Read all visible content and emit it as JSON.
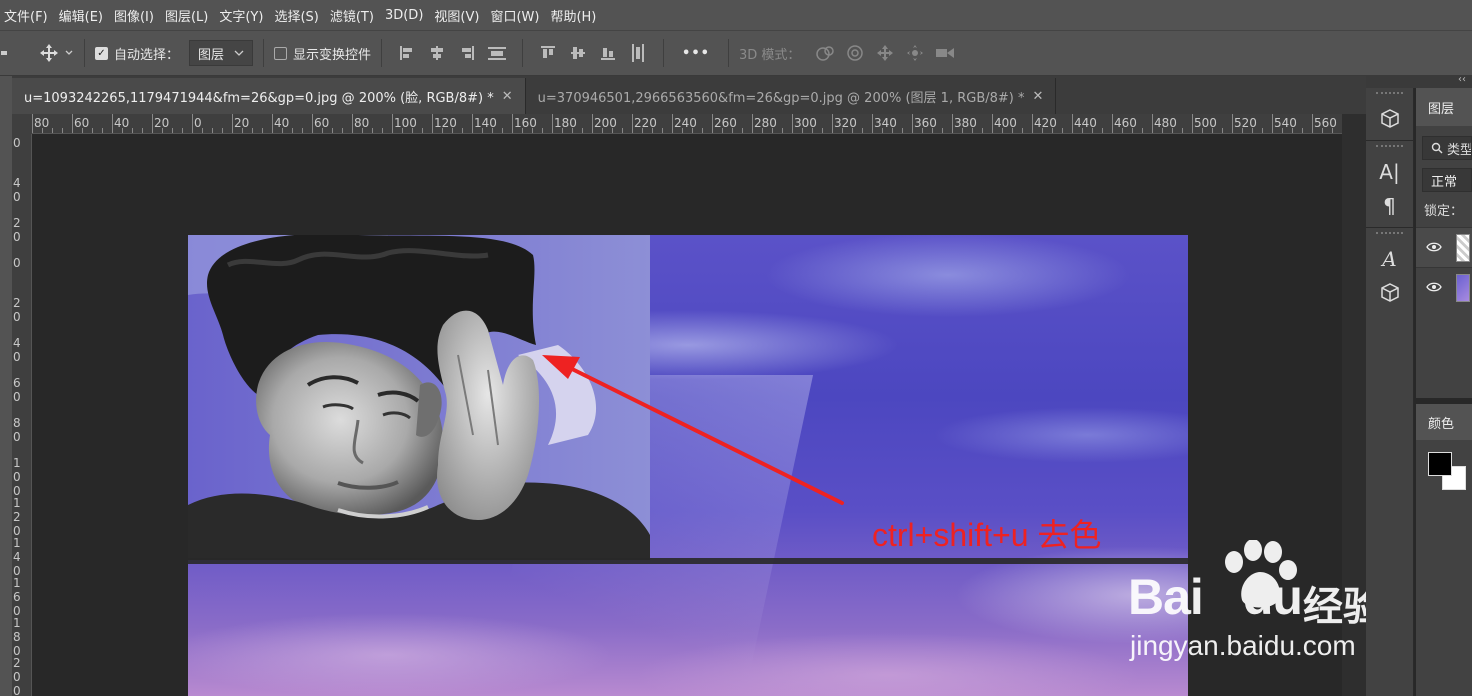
{
  "menu": [
    "文件(F)",
    "编辑(E)",
    "图像(I)",
    "图层(L)",
    "文字(Y)",
    "选择(S)",
    "滤镜(T)",
    "3D(D)",
    "视图(V)",
    "窗口(W)",
    "帮助(H)"
  ],
  "options": {
    "auto_select_label": "自动选择：",
    "auto_select_checked": true,
    "auto_select_target": "图层",
    "show_transform_label": "显示变换控件",
    "show_transform_checked": false,
    "more_label": "•••",
    "mode_3d_label": "3D 模式："
  },
  "tabs": [
    {
      "title": "u=1093242265,1179471944&fm=26&gp=0.jpg @ 200% (脸, RGB/8#) *",
      "active": true
    },
    {
      "title": "u=370946501,2966563560&fm=26&gp=0.jpg @ 200% (图层 1, RGB/8#) *",
      "active": false
    }
  ],
  "ruler": {
    "h_labels": [
      "80",
      "60",
      "40",
      "20",
      "0",
      "20",
      "40",
      "60",
      "80",
      "100",
      "120",
      "140",
      "160",
      "180",
      "200",
      "220",
      "240",
      "260",
      "280",
      "300",
      "320",
      "340",
      "360",
      "380",
      "400",
      "420",
      "440",
      "460",
      "480",
      "500",
      "520",
      "540",
      "560"
    ],
    "v_labels": [
      "0",
      "40",
      "20",
      "0",
      "20",
      "40",
      "60",
      "80",
      "100",
      "120",
      "140",
      "160",
      "180",
      "200"
    ]
  },
  "canvas": {
    "annotation": "ctrl+shift+u 去色",
    "annotation_color": "#ee2222"
  },
  "watermark": {
    "brand": "Bai",
    "brand_tail": "du",
    "cn": "经验",
    "url": "jingyan.baidu.com"
  },
  "panels": {
    "collapse_glyph": "‹‹",
    "layers_title": "图层",
    "search_text": "类型",
    "blend_mode": "正常",
    "lock_label": "锁定：",
    "color_title": "颜色",
    "foreground": "#000000",
    "background": "#ffffff"
  },
  "tool_icons": [
    "3d-object-icon",
    "character-icon",
    "paragraph-icon",
    "glyphs-icon",
    "3d-cube-icon"
  ]
}
